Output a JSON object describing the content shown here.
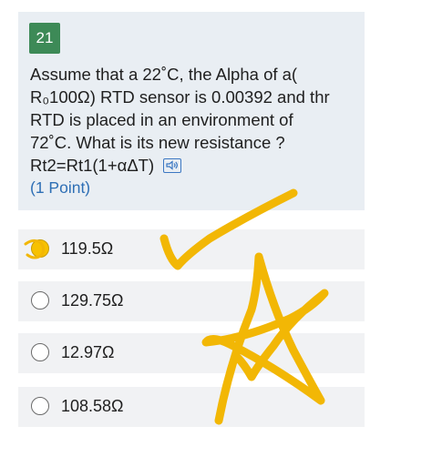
{
  "question": {
    "number": "21",
    "lines": [
      "Assume that a 22˚C, the Alpha of a(",
      "R₀100Ω) RTD sensor is 0.00392 and thr",
      "RTD is placed in an environment of",
      "72˚C. What is its new resistance ?",
      "Rt2=Rt1(1+αΔT)"
    ],
    "points": "(1 Point)",
    "immersive_reader_icon": "speaker-icon"
  },
  "options": [
    {
      "label": "119.5Ω",
      "selected": true
    },
    {
      "label": "129.75Ω",
      "selected": false
    },
    {
      "label": "12.97Ω",
      "selected": false
    },
    {
      "label": "108.58Ω",
      "selected": false
    }
  ],
  "colors": {
    "question_bg": "#e9eef3",
    "number_badge": "#3d8a57",
    "points_text": "#2e6fb5",
    "annotation_yellow": "#f2b705"
  }
}
